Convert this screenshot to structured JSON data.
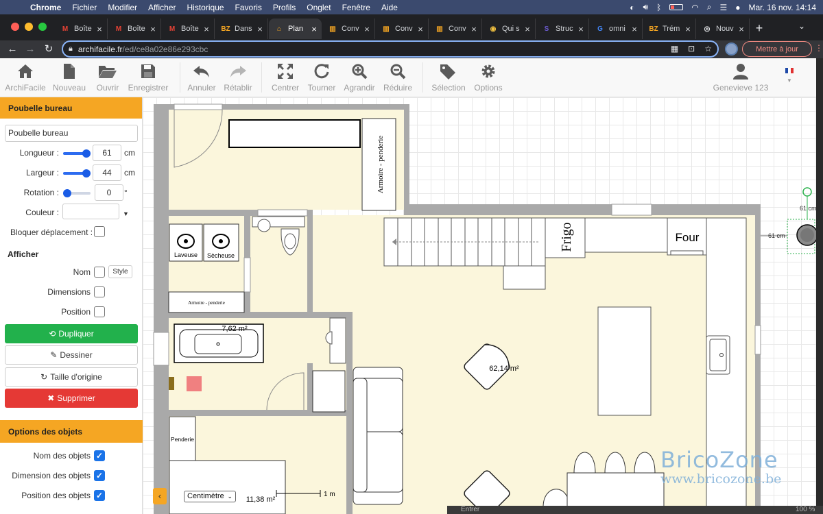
{
  "mac_menubar": {
    "items": [
      "Chrome",
      "Fichier",
      "Modifier",
      "Afficher",
      "Historique",
      "Favoris",
      "Profils",
      "Onglet",
      "Fenêtre",
      "Aide"
    ],
    "clock": "Mar. 16 nov.  14:14"
  },
  "tabs": [
    {
      "label": "Boîte",
      "fav": "M",
      "color": "#ea4335"
    },
    {
      "label": "Boîte",
      "fav": "M",
      "color": "#ea4335"
    },
    {
      "label": "Boîte",
      "fav": "M",
      "color": "#ea4335"
    },
    {
      "label": "Dans",
      "fav": "BZ",
      "color": "#f5a623"
    },
    {
      "label": "Plan",
      "fav": "⌂",
      "color": "#f5a623"
    },
    {
      "label": "Conv",
      "fav": "▥",
      "color": "#f5a623"
    },
    {
      "label": "Conv",
      "fav": "▥",
      "color": "#f5a623"
    },
    {
      "label": "Conv",
      "fav": "▥",
      "color": "#f5a623"
    },
    {
      "label": "Qui s",
      "fav": "◉",
      "color": "#f0c040"
    },
    {
      "label": "Struc",
      "fav": "S",
      "color": "#6a5acd"
    },
    {
      "label": "omni",
      "fav": "G",
      "color": "#4285f4"
    },
    {
      "label": "Trém",
      "fav": "BZ",
      "color": "#f5a623"
    },
    {
      "label": "Nouv",
      "fav": "◎",
      "color": "#e8eaed"
    }
  ],
  "active_tab_index": 4,
  "address": {
    "host": "archifacile.fr",
    "path": "/ed/ce8a02e86e293cbc",
    "update_label": "Mettre à jour"
  },
  "toolbar": {
    "home": "ArchiFacile",
    "new": "Nouveau",
    "open": "Ouvrir",
    "save": "Enregistrer",
    "undo": "Annuler",
    "redo": "Rétablir",
    "center": "Centrer",
    "rotate": "Tourner",
    "zoom_in": "Agrandir",
    "zoom_out": "Réduire",
    "selection": "Sélection",
    "options": "Options",
    "user": "Genevieve 123"
  },
  "object_panel": {
    "title": "Poubelle bureau",
    "name_value": "Poubelle bureau",
    "length_label": "Longueur :",
    "length_value": "61",
    "length_unit": "cm",
    "length_level": 1.0,
    "width_label": "Largeur :",
    "width_value": "44",
    "width_unit": "cm",
    "width_level": 1.0,
    "rotation_label": "Rotation :",
    "rotation_value": "0",
    "rotation_unit": "°",
    "rotation_level": 0.0,
    "color_label": "Couleur :",
    "lock_label": "Bloquer déplacement :",
    "show_title": "Afficher",
    "show_name": "Nom",
    "style_label": "Style",
    "show_dimensions": "Dimensions",
    "show_position": "Position",
    "duplicate": "Dupliquer",
    "draw": "Dessiner",
    "original_size": "Taille d'origine",
    "delete": "Supprimer"
  },
  "options_panel": {
    "title": "Options des objets",
    "object_names": "Nom des objets",
    "object_dimensions": "Dimension des objets",
    "object_positions": "Position des objets"
  },
  "plan": {
    "wardrobe_label": "Armoire - penderie",
    "wardrobe_label_small": "Armoire - penderie",
    "washer": "Laveuse",
    "dryer": "Sècheuse",
    "fridge": "Frigo",
    "oven": "Four",
    "area_bath": "7,62 m²",
    "area_main": "62,14 m²",
    "area_bottom": "11,38 m²",
    "closet": "Penderie",
    "dim_top": "61 cm",
    "dim_side": "61 cm",
    "scale": "1 m",
    "unit_select": "Centimètre"
  },
  "bottom_status": {
    "left": "Entrer",
    "right": "100 %"
  },
  "watermark": {
    "brand": "BricoZone",
    "site": "www.bricozone.be"
  }
}
